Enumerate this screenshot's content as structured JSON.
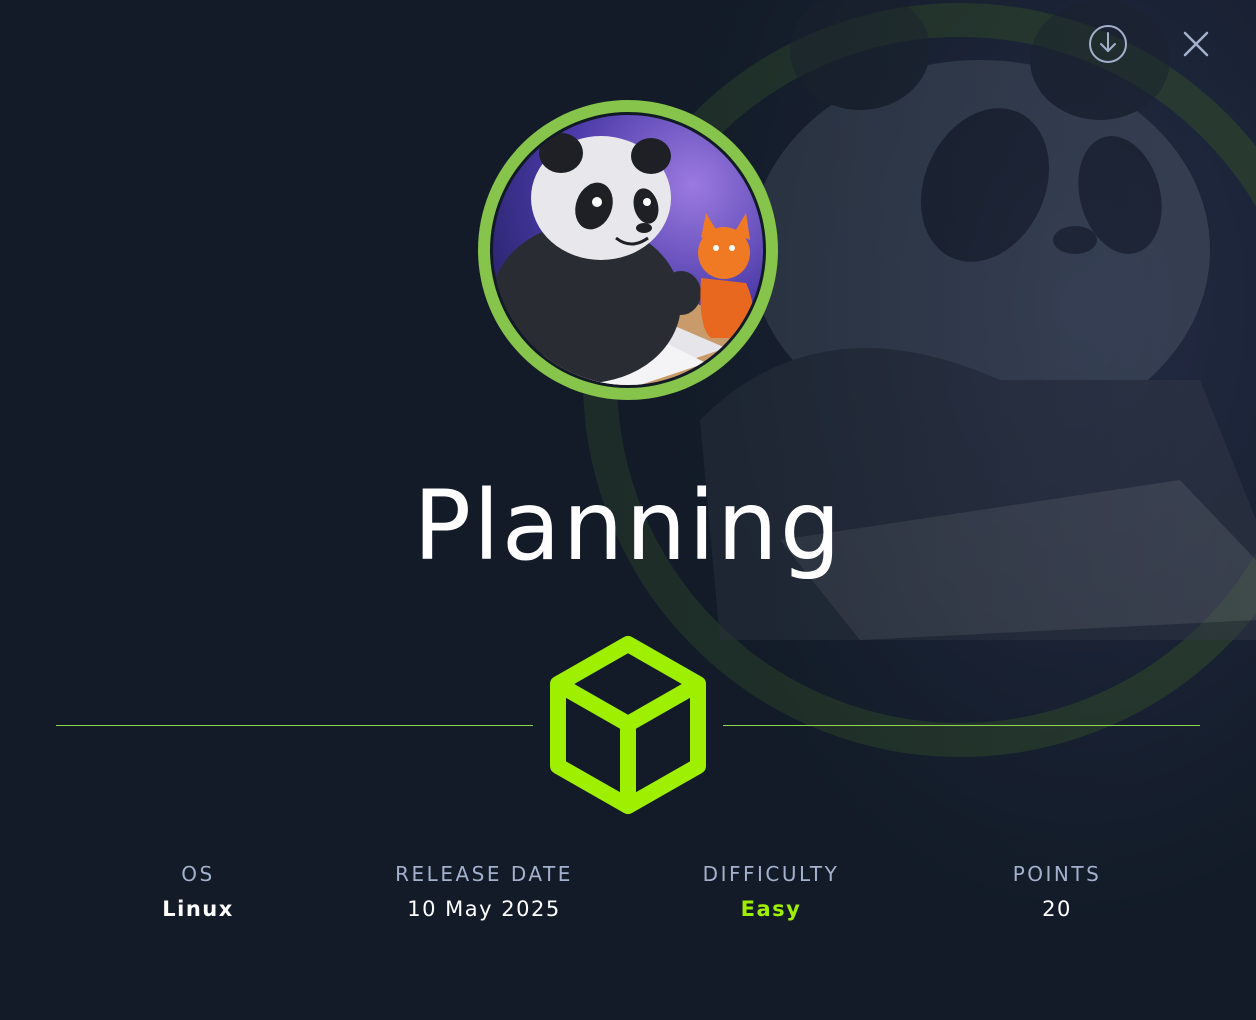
{
  "machine": {
    "name": "Planning"
  },
  "actions": {
    "download_icon": "download-icon",
    "close_icon": "close-icon"
  },
  "stats": {
    "os": {
      "label": "OS",
      "value": "Linux"
    },
    "release": {
      "label": "RELEASE DATE",
      "value": "10 May 2025"
    },
    "difficulty": {
      "label": "DIFFICULTY",
      "value": "Easy"
    },
    "points": {
      "label": "POINTS",
      "value": "20"
    }
  },
  "colors": {
    "background": "#121b27",
    "accent_green": "#9fef00",
    "ring_green": "#86c44b",
    "label_gray": "#a4b1cd"
  }
}
